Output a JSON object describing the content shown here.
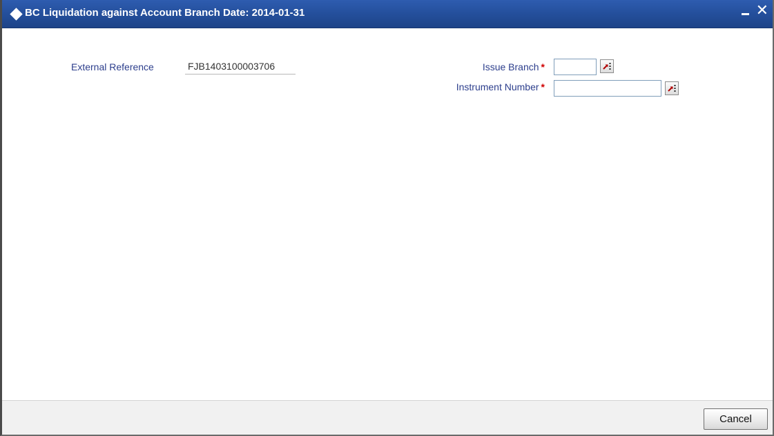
{
  "window": {
    "title": "BC Liquidation against Account  Branch Date: 2014-01-31",
    "minimize_icon": "minimize-icon",
    "close_icon": "close-icon",
    "close_glyph": "✕"
  },
  "form": {
    "external_reference": {
      "label": "External Reference",
      "value": "FJB1403100003706"
    },
    "issue_branch": {
      "label": "Issue Branch",
      "required_marker": "*",
      "value": "",
      "lov_icon": "list-of-values-icon"
    },
    "instrument_number": {
      "label": "Instrument Number",
      "required_marker": "*",
      "value": "",
      "lov_icon": "list-of-values-icon"
    }
  },
  "footer": {
    "cancel_label": "Cancel"
  },
  "colors": {
    "titlebar": "#244f9c",
    "label_text": "#2c3e8c",
    "required_marker": "#d00000",
    "footer_bg": "#f1f1f1"
  }
}
